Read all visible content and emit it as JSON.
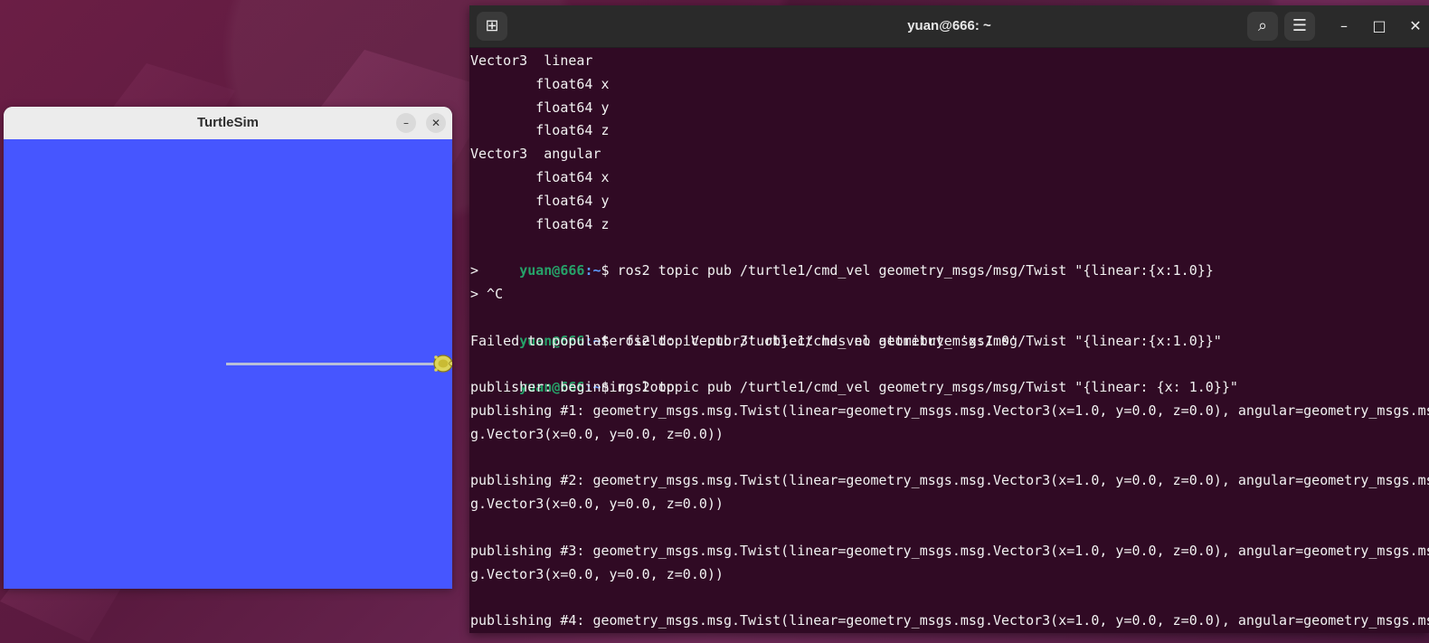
{
  "turtlesim": {
    "title": "TurtleSim",
    "minimize_label": "–",
    "close_label": "✕",
    "canvas_color": "#4656ff",
    "icons": [
      "minimize-icon",
      "close-icon",
      "turtle-icon"
    ]
  },
  "terminal": {
    "title": "yuan@666: ~",
    "new_tab_icon": "new-tab-icon",
    "new_tab_label": "⊞",
    "search_label": "⌕",
    "menu_label": "☰",
    "minimize_label": "–",
    "maximize_label": "□",
    "close_label": "✕",
    "lines": [
      {
        "text": "Vector3  linear"
      },
      {
        "text": "        float64 x"
      },
      {
        "text": "        float64 y"
      },
      {
        "text": "        float64 z"
      },
      {
        "text": "Vector3  angular"
      },
      {
        "text": "        float64 x"
      },
      {
        "text": "        float64 y"
      },
      {
        "text": "        float64 z"
      },
      {
        "user": "yuan@666",
        "path": "~",
        "command": "ros2 topic pub /turtle1/cmd_vel geometry_msgs/msg/Twist \"{linear:{x:1.0}}"
      },
      {
        "text": ">"
      },
      {
        "text": "> ^C"
      },
      {
        "user": "yuan@666",
        "path": "~",
        "command": "ros2 topic pub /turtle1/cmd_vel geometry_msgs/msg/Twist \"{linear:{x:1.0}}\""
      },
      {
        "text": "Failed to populate field: 'Vector3' object has no attribute 'x:1.0'"
      },
      {
        "user": "yuan@666",
        "path": "~",
        "command": "ros2 topic pub /turtle1/cmd_vel geometry_msgs/msg/Twist \"{linear: {x: 1.0}}\""
      },
      {
        "text": "publisher: beginning loop"
      },
      {
        "text": "publishing #1: geometry_msgs.msg.Twist(linear=geometry_msgs.msg.Vector3(x=1.0, y=0.0, z=0.0), angular=geometry_msgs.ms"
      },
      {
        "text": "g.Vector3(x=0.0, y=0.0, z=0.0))"
      },
      {
        "text": ""
      },
      {
        "text": "publishing #2: geometry_msgs.msg.Twist(linear=geometry_msgs.msg.Vector3(x=1.0, y=0.0, z=0.0), angular=geometry_msgs.ms"
      },
      {
        "text": "g.Vector3(x=0.0, y=0.0, z=0.0))"
      },
      {
        "text": ""
      },
      {
        "text": "publishing #3: geometry_msgs.msg.Twist(linear=geometry_msgs.msg.Vector3(x=1.0, y=0.0, z=0.0), angular=geometry_msgs.ms"
      },
      {
        "text": "g.Vector3(x=0.0, y=0.0, z=0.0))"
      },
      {
        "text": ""
      },
      {
        "text": "publishing #4: geometry_msgs.msg.Twist(linear=geometry_msgs.msg.Vector3(x=1.0, y=0.0, z=0.0), angular=geometry_msgs.ms"
      }
    ]
  }
}
